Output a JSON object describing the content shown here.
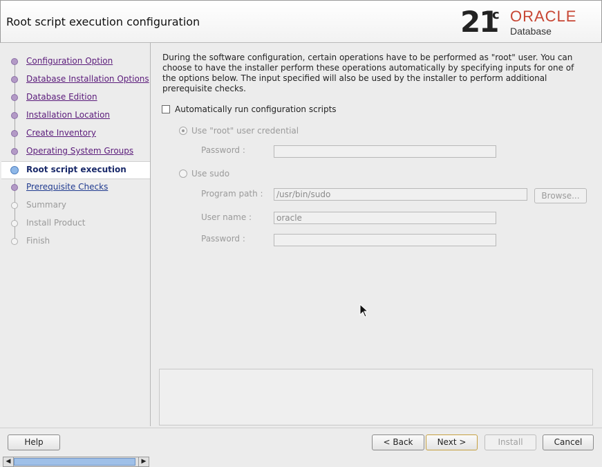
{
  "window": {
    "title": "Root script execution configuration"
  },
  "logo": {
    "version": "21",
    "superscript": "c",
    "brand": "ORACLE",
    "product": "Database",
    "brand_color": "#c74634"
  },
  "nav": {
    "steps": [
      {
        "label": "Configuration Option",
        "state": "done"
      },
      {
        "label": "Database Installation Options",
        "state": "done"
      },
      {
        "label": "Database Edition",
        "state": "done"
      },
      {
        "label": "Installation Location",
        "state": "done"
      },
      {
        "label": "Create Inventory",
        "state": "done"
      },
      {
        "label": "Operating System Groups",
        "state": "done"
      },
      {
        "label": "Root script execution",
        "state": "current"
      },
      {
        "label": "Prerequisite Checks",
        "state": "next"
      },
      {
        "label": "Summary",
        "state": "pending"
      },
      {
        "label": "Install Product",
        "state": "pending"
      },
      {
        "label": "Finish",
        "state": "pending"
      }
    ]
  },
  "main": {
    "intro": "During the software configuration, certain operations have to be performed as \"root\" user. You can choose to have the installer perform these operations automatically by specifying inputs for one of the options below. The input specified will also be used by the installer to perform additional prerequisite checks.",
    "auto_run_label": "Automatically run configuration scripts",
    "auto_run_checked": false,
    "root_option": {
      "label": "Use \"root\" user credential",
      "password_label": "Password :",
      "password_value": ""
    },
    "sudo_option": {
      "label": "Use sudo",
      "program_path_label": "Program path :",
      "program_path_value": "/usr/bin/sudo",
      "browse_label": "Browse...",
      "user_name_label": "User name :",
      "user_name_value": "oracle",
      "password_label": "Password :",
      "password_value": ""
    }
  },
  "footer": {
    "help": "Help",
    "back": "< Back",
    "next": "Next >",
    "install": "Install",
    "cancel": "Cancel"
  }
}
